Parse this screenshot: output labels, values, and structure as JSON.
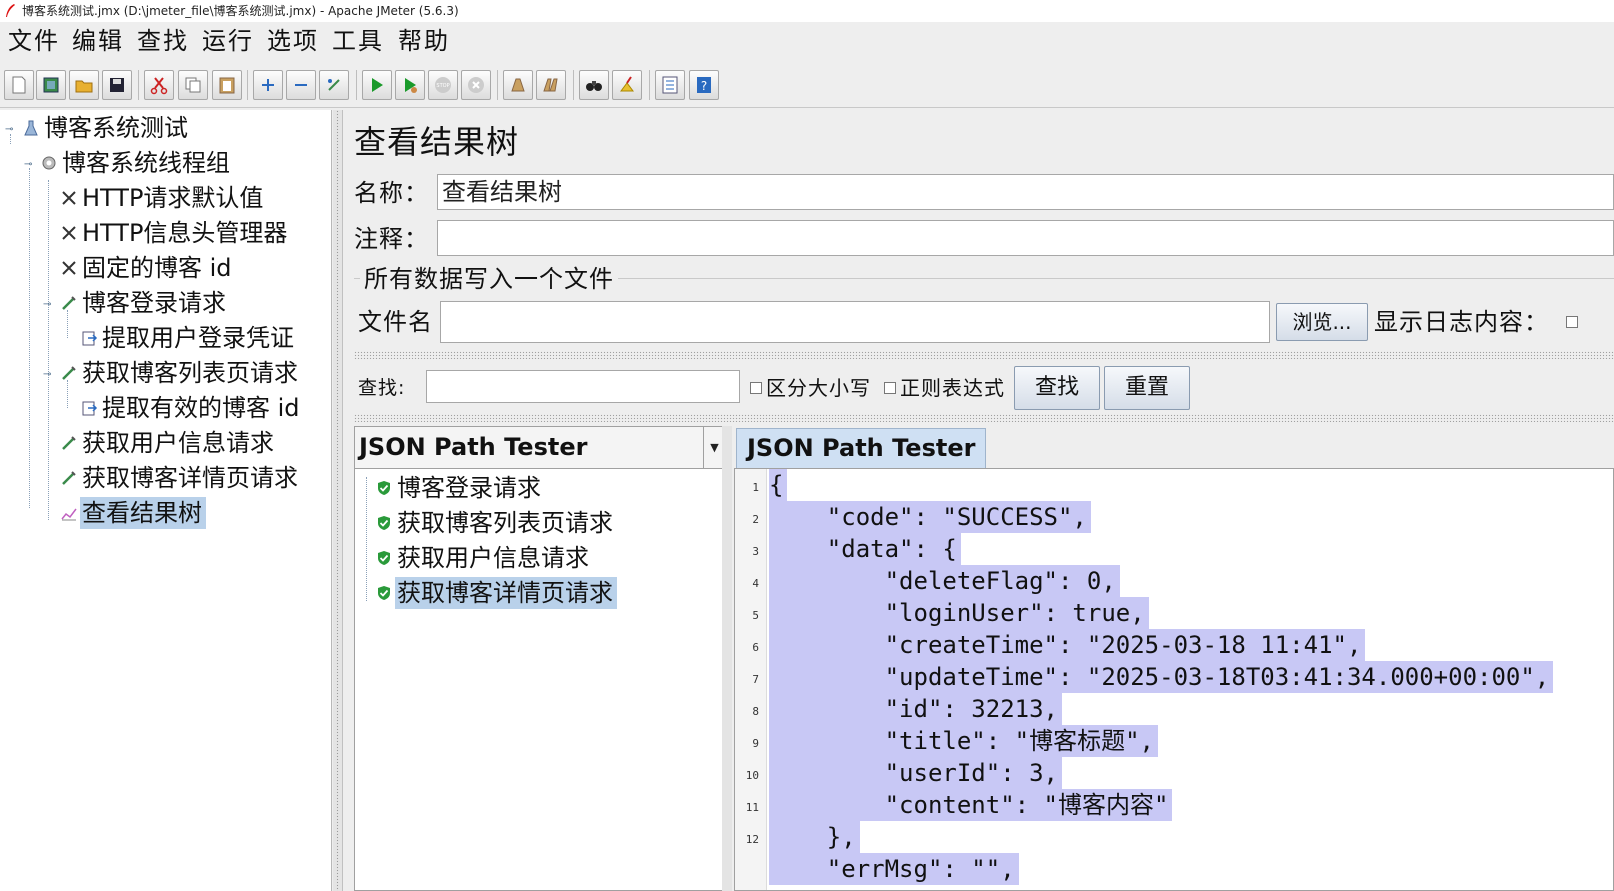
{
  "window": {
    "title": "博客系统测试.jmx (D:\\jmeter_file\\博客系统测试.jmx) - Apache JMeter (5.6.3)"
  },
  "menu": {
    "file": "文件",
    "edit": "编辑",
    "search": "查找",
    "run": "运行",
    "options": "选项",
    "tools": "工具",
    "help": "帮助"
  },
  "toolbar": {
    "icons": [
      "new-icon",
      "templates-icon",
      "open-icon",
      "save-icon",
      "cut-icon",
      "copy-icon",
      "paste-icon",
      "expand-icon",
      "collapse-icon",
      "toggle-icon",
      "start-icon",
      "start-no-pause-icon",
      "stop-icon",
      "shutdown-icon",
      "clear-icon",
      "clear-all-icon",
      "search-icon",
      "reset-search-icon",
      "function-helper-icon",
      "help-icon"
    ]
  },
  "tree": {
    "root": "博客系统测试",
    "thread_group": "博客系统线程组",
    "items": [
      {
        "label": "HTTP请求默认值"
      },
      {
        "label": "HTTP信息头管理器"
      },
      {
        "label": "固定的博客 id"
      },
      {
        "label": "博客登录请求"
      },
      {
        "label": "提取用户登录凭证"
      },
      {
        "label": "获取博客列表页请求"
      },
      {
        "label": "提取有效的博客 id"
      },
      {
        "label": "获取用户信息请求"
      },
      {
        "label": "获取博客详情页请求"
      },
      {
        "label": "查看结果树"
      }
    ]
  },
  "panel": {
    "title": "查看结果树",
    "name_label": "名称：",
    "name_value": "查看结果树",
    "comment_label": "注释：",
    "comment_value": "",
    "file_section_title": "所有数据写入一个文件",
    "filename_label": "文件名",
    "filename_value": "",
    "browse_button": "浏览...",
    "show_log_label": "显示日志内容："
  },
  "search": {
    "label": "查找:",
    "value": "",
    "case_sensitive": "区分大小写",
    "regex": "正则表达式",
    "find_button": "查找",
    "reset_button": "重置"
  },
  "renderer": {
    "selected": "JSON Path Tester",
    "samples": [
      {
        "label": "博客登录请求"
      },
      {
        "label": "获取博客列表页请求"
      },
      {
        "label": "获取用户信息请求"
      },
      {
        "label": "获取博客详情页请求"
      }
    ]
  },
  "result": {
    "tab": "JSON Path Tester",
    "line_numbers": [
      "1",
      "2",
      "3",
      "4",
      "5",
      "6",
      "7",
      "8",
      "9",
      "10",
      "11",
      "12"
    ],
    "lines": [
      "{",
      "    \"code\": \"SUCCESS\",",
      "    \"data\": {",
      "        \"deleteFlag\": 0,",
      "        \"loginUser\": true,",
      "        \"createTime\": \"2025-03-18 11:41\",",
      "        \"updateTime\": \"2025-03-18T03:41:34.000+00:00\",",
      "        \"id\": 32213,",
      "        \"title\": \"博客标题\",",
      "        \"userId\": 3,",
      "        \"content\": \"博客内容\"",
      "    },",
      "    \"errMsg\": \"\","
    ]
  },
  "colors": {
    "selection": "#b9d1ea",
    "code_highlight": "#c8c8f5",
    "success": "#2a9a3a"
  }
}
